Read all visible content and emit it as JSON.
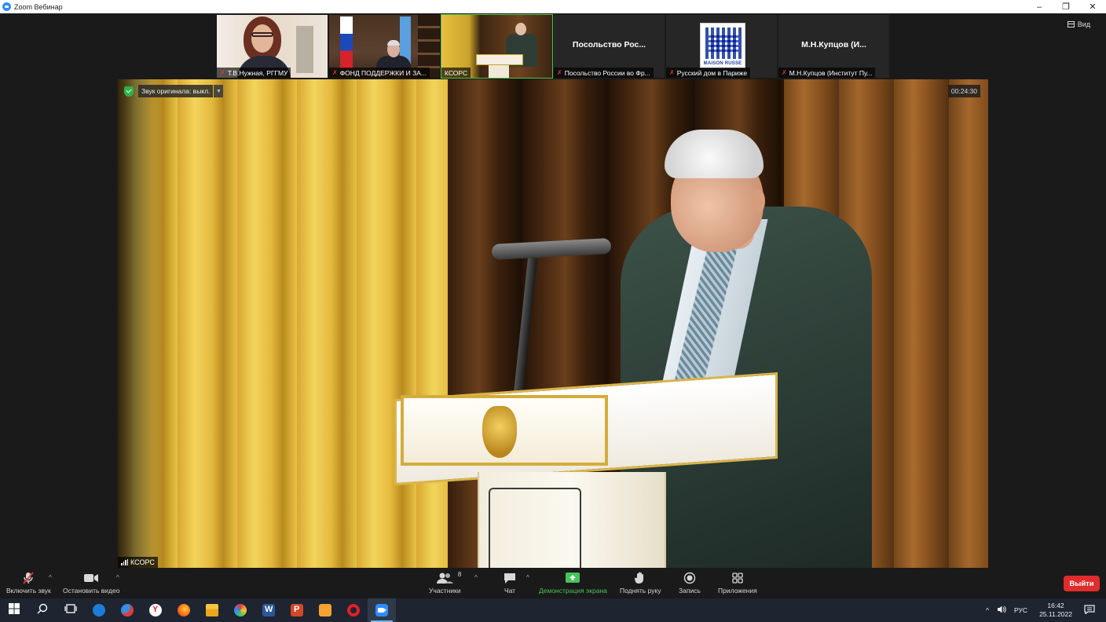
{
  "window": {
    "title": "Zoom Вебинар",
    "controls": [
      "–",
      "❐",
      "✕"
    ]
  },
  "view_button": "Вид",
  "participants": [
    {
      "name": "Т.В.Нужная, РГГМУ",
      "video": true,
      "muted": true
    },
    {
      "name": "ФОНД ПОДДЕРЖКИ И ЗА...",
      "video": true,
      "muted": true
    },
    {
      "name": "КСОРС",
      "video": true,
      "muted": false,
      "active": true
    },
    {
      "name": "Посольство России во Фр...",
      "display": "Посольство Рос...",
      "video": false,
      "muted": true
    },
    {
      "name": "Русский дом в Париже",
      "logo_text": "MAISON RUSSE",
      "video": false,
      "muted": true
    },
    {
      "name": "М.Н.Купцов (Институт Пу...",
      "display": "М.Н.Купцов (И...",
      "video": false,
      "muted": true
    }
  ],
  "main_video": {
    "original_sound_label": "Звук оригинала: выкл.",
    "timer": "00:24:30",
    "speaker_name": "КСОРС"
  },
  "toolbar": {
    "unmute": "Включить звук",
    "stop_video": "Остановить видео",
    "participants": "Участники",
    "participants_count": "8",
    "chat": "Чат",
    "share_screen": "Демонстрация экрана",
    "raise_hand": "Поднять руку",
    "record": "Запись",
    "apps": "Приложения",
    "exit": "Выйти"
  },
  "taskbar": {
    "apps": [
      "start",
      "search",
      "task-view",
      "edge",
      "mail",
      "yandex",
      "firefox",
      "file-explorer",
      "photos",
      "word",
      "powerpoint",
      "slides",
      "opera",
      "zoom"
    ],
    "language": "РУС",
    "time": "16:42",
    "date": "25.11.2022"
  },
  "colors": {
    "accent_green": "#46c35b",
    "exit_red": "#e02c2c",
    "zoom_blue": "#2d8cff"
  }
}
